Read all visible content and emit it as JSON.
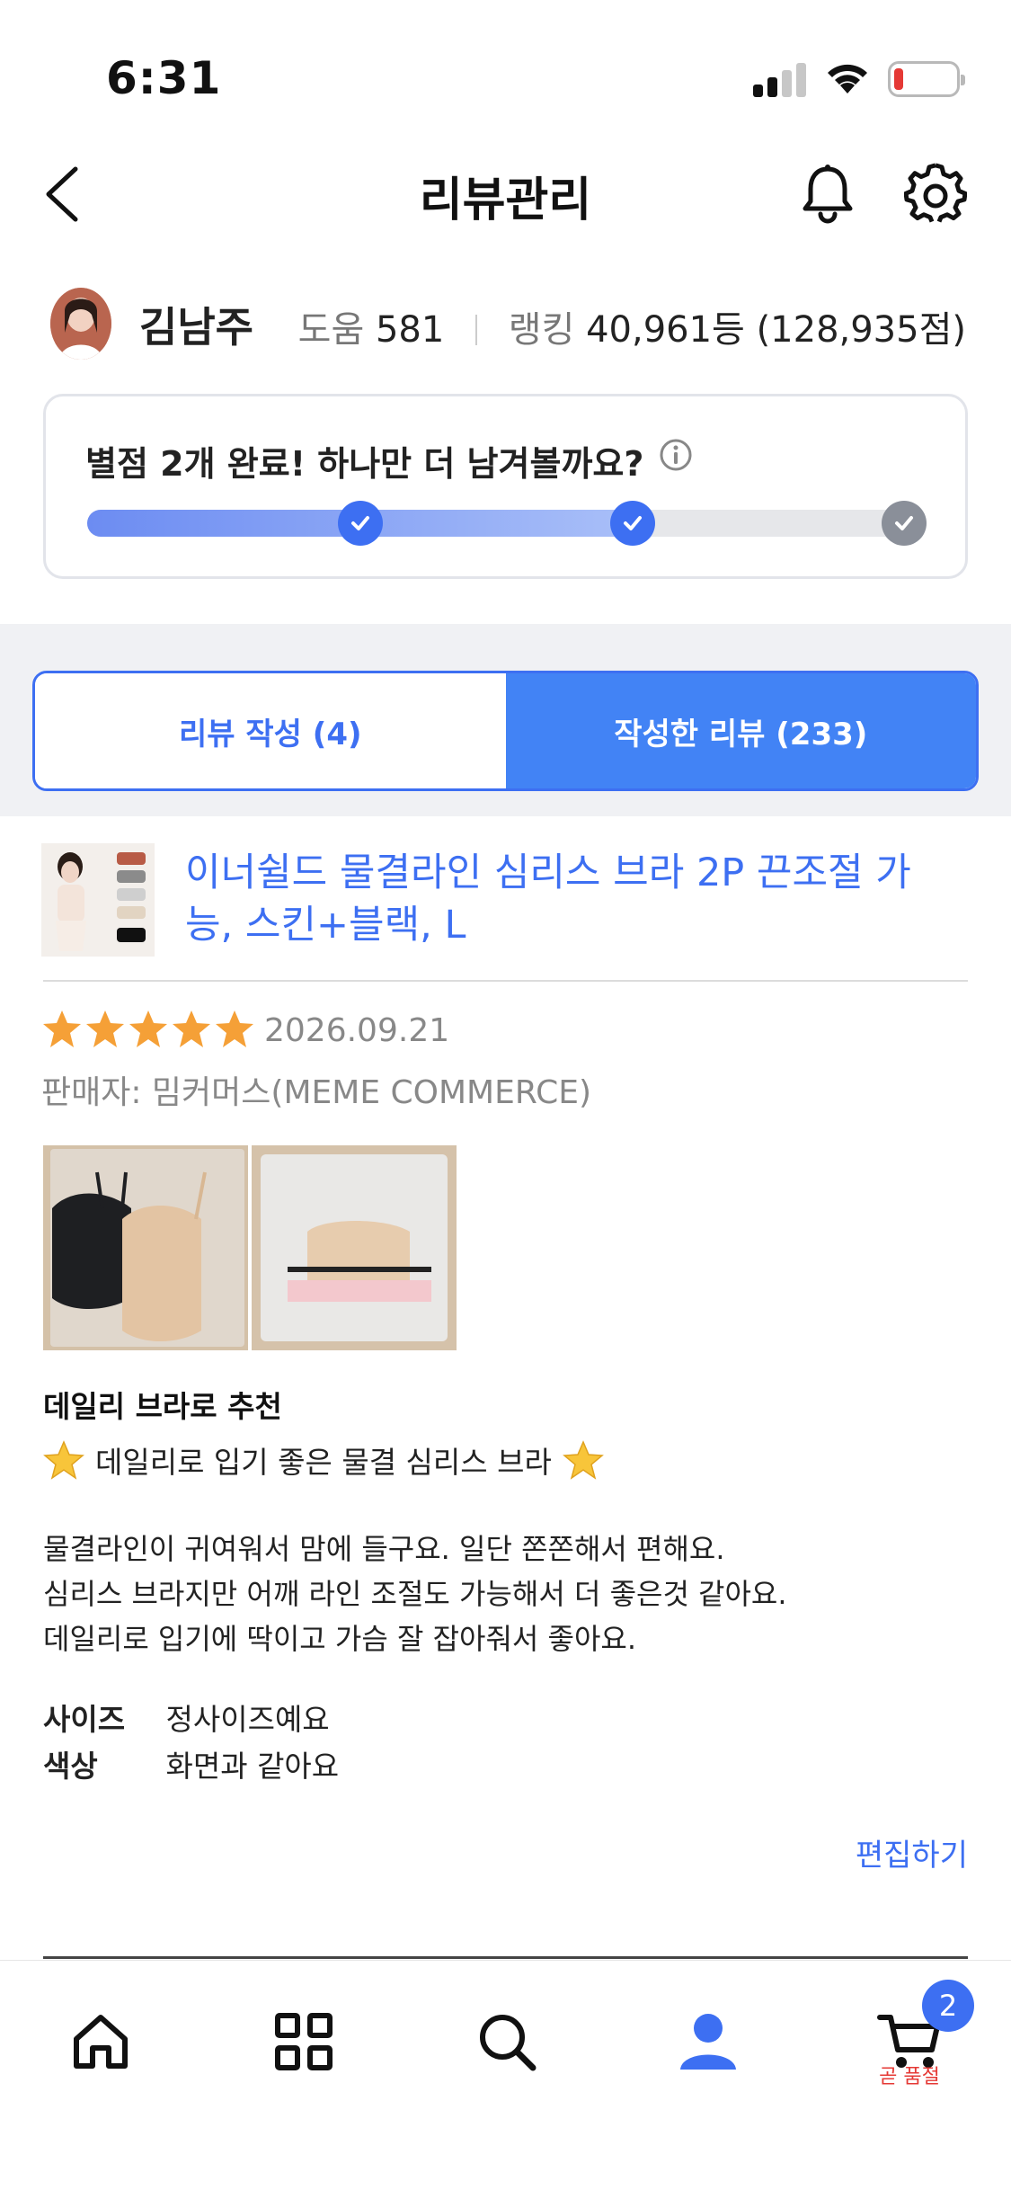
{
  "status_bar": {
    "time": "6:31"
  },
  "header": {
    "title": "리뷰관리"
  },
  "profile": {
    "name": "김남주",
    "help_label": "도움",
    "help_count": "581",
    "ranking_label": "랭킹",
    "ranking_value": "40,961등 (128,935점)"
  },
  "progress": {
    "message": "별점 2개 완료! 하나만 더 남겨볼까요?",
    "completed": 2,
    "total": 3
  },
  "tabs": {
    "write": "리뷰 작성 (4)",
    "written": "작성한 리뷰 (233)"
  },
  "review": {
    "product_name": "이너쉴드 물결라인 심리스 브라 2P 끈조절 가능, 스킨+블랙, L",
    "rating": 5,
    "date": "2026.09.21",
    "seller": "판매자: 밈커머스(MEME COMMERCE)",
    "title": "데일리 브라로 추천",
    "subtitle": "데일리로 입기 좋은 물결 심리스 브라",
    "body_lines": [
      "물결라인이 귀여워서 맘에 들구요. 일단 쫀쫀해서 편해요.",
      "심리스 브라지만 어깨 라인 조절도 가능해서 더 좋은것 같아요.",
      "데일리로 입기에 딱이고 가슴 잘 잡아줘서 좋아요."
    ],
    "attributes": [
      {
        "key": "사이즈",
        "value": "정사이즈예요"
      },
      {
        "key": "색상",
        "value": "화면과 같아요"
      }
    ],
    "edit_label": "편집하기"
  },
  "tabbar": {
    "cart_badge": "2",
    "cart_note": "곧 품절",
    "items": [
      "home-icon",
      "category-icon",
      "search-icon",
      "profile-icon",
      "cart-icon"
    ]
  },
  "colors": {
    "accent": "#3d6ff2",
    "star": "#f5a037",
    "warning": "#e53935"
  }
}
